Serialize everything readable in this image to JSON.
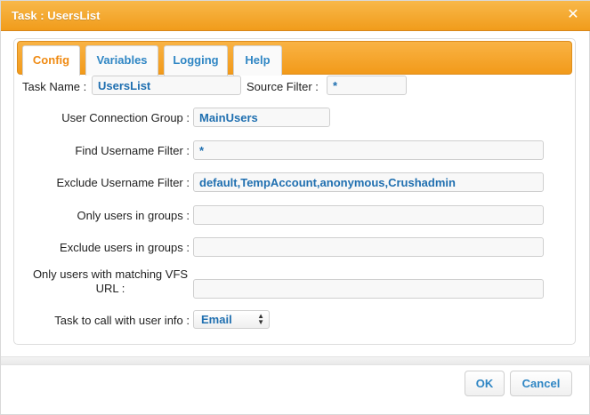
{
  "window": {
    "title": "Task : UsersList",
    "close_icon": "close-icon"
  },
  "tabs": [
    {
      "label": "Config",
      "active": true
    },
    {
      "label": "Variables",
      "active": false
    },
    {
      "label": "Logging",
      "active": false
    },
    {
      "label": "Help",
      "active": false
    }
  ],
  "form": {
    "task_name": {
      "label": "Task Name :",
      "value": "UsersList"
    },
    "source_filter": {
      "label": "Source Filter :",
      "value": "*"
    },
    "user_connection_group": {
      "label": "User Connection Group :",
      "value": "MainUsers"
    },
    "find_username_filter": {
      "label": "Find Username Filter :",
      "value": "*"
    },
    "exclude_username_filter": {
      "label": "Exclude Username Filter :",
      "value": "default,TempAccount,anonymous,Crushadmin"
    },
    "only_users_in_groups": {
      "label": "Only users in groups :",
      "value": ""
    },
    "exclude_users_in_groups": {
      "label": "Exclude users in groups :",
      "value": ""
    },
    "only_users_matching_vfs_url": {
      "label": "Only users with matching VFS URL :",
      "value": ""
    },
    "task_to_call": {
      "label": "Task to call with user info :",
      "value": "Email"
    }
  },
  "buttons": {
    "ok": "OK",
    "cancel": "Cancel"
  },
  "colors": {
    "accent": "#F29A1A",
    "link": "#2F86C4",
    "active_tab_text": "#EF8A12"
  }
}
